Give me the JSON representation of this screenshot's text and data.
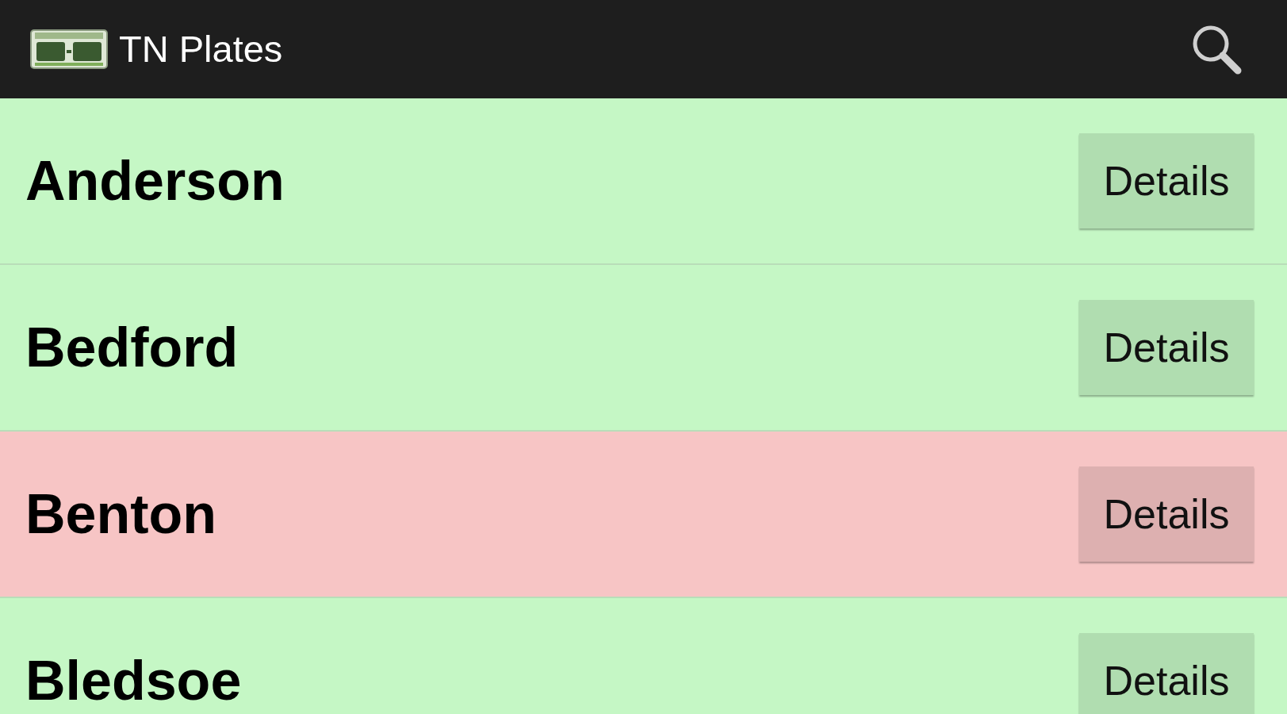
{
  "action_bar": {
    "title": "TN Plates"
  },
  "counties": [
    {
      "name": "Anderson",
      "color": "#c5f7c5",
      "button": "Details"
    },
    {
      "name": "Bedford",
      "color": "#c5f7c5",
      "button": "Details"
    },
    {
      "name": "Benton",
      "color": "#f7c5c5",
      "button": "Details"
    },
    {
      "name": "Bledsoe",
      "color": "#c5f7c5",
      "button": "Details"
    }
  ]
}
